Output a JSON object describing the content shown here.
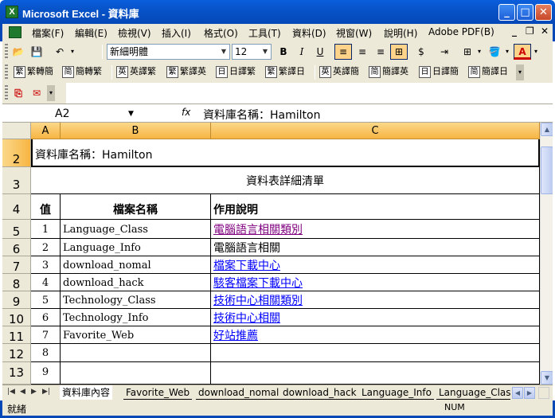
{
  "window": {
    "title": "Microsoft Excel - 資料庫",
    "app_icon": "X"
  },
  "menu": [
    "檔案(F)",
    "編輯(E)",
    "檢視(V)",
    "插入(I)",
    "格式(O)",
    "工具(T)",
    "資料(D)",
    "視窗(W)",
    "說明(H)",
    "Adobe PDF(B)"
  ],
  "toolbar": {
    "font": "新細明體",
    "size": "12",
    "bold": "B",
    "italic": "I",
    "underline": "U",
    "currency": "$"
  },
  "translate_toolbar": [
    {
      "icon": "繁",
      "label": "繁轉簡"
    },
    {
      "icon": "简",
      "label": "簡轉繁"
    },
    {
      "icon": "英",
      "label": "英譯繁"
    },
    {
      "icon": "繁",
      "label": "繁譯英"
    },
    {
      "icon": "日",
      "label": "日譯繁"
    },
    {
      "icon": "繁",
      "label": "繁譯日"
    },
    {
      "icon": "英",
      "label": "英譯簡"
    },
    {
      "icon": "简",
      "label": "簡譯英"
    },
    {
      "icon": "日",
      "label": "日譯簡"
    },
    {
      "icon": "简",
      "label": "簡譯日"
    }
  ],
  "formula": {
    "namebox": "A2",
    "fx": "fx",
    "content": "資料庫名稱：Hamilton"
  },
  "columns": [
    "A",
    "B",
    "C"
  ],
  "rows": [
    "2",
    "3",
    "4",
    "5",
    "6",
    "7",
    "8",
    "9",
    "10",
    "11",
    "12",
    "13"
  ],
  "sheet": {
    "db_name": "資料庫名稱：Hamilton",
    "table_title": "資料表詳細清單",
    "headers": [
      "值",
      "檔案名稱",
      "作用說明"
    ],
    "data": [
      {
        "n": "1",
        "file": "Language_Class",
        "desc": "電腦語言相關類別",
        "link": "visited"
      },
      {
        "n": "2",
        "file": "Language_Info",
        "desc": "電腦語言相關",
        "link": "none"
      },
      {
        "n": "3",
        "file": "download_nomal",
        "desc": "檔案下載中心",
        "link": "link"
      },
      {
        "n": "4",
        "file": "download_hack",
        "desc": "駭客檔案下載中心",
        "link": "link"
      },
      {
        "n": "5",
        "file": "Technology_Class",
        "desc": "技術中心相關類別",
        "link": "link"
      },
      {
        "n": "6",
        "file": "Technology_Info",
        "desc": "技術中心相關",
        "link": "link"
      },
      {
        "n": "7",
        "file": "Favorite_Web",
        "desc": "好站推薦",
        "link": "link"
      },
      {
        "n": "8",
        "file": "",
        "desc": "",
        "link": "none"
      },
      {
        "n": "9",
        "file": "",
        "desc": "",
        "link": "none"
      }
    ]
  },
  "tabs": [
    "資料庫內容",
    "Favorite_Web",
    "download_nomal",
    "download_hack",
    "Language_Info",
    "Language_Clas"
  ],
  "status": {
    "left": "就緒",
    "num": "NUM"
  }
}
